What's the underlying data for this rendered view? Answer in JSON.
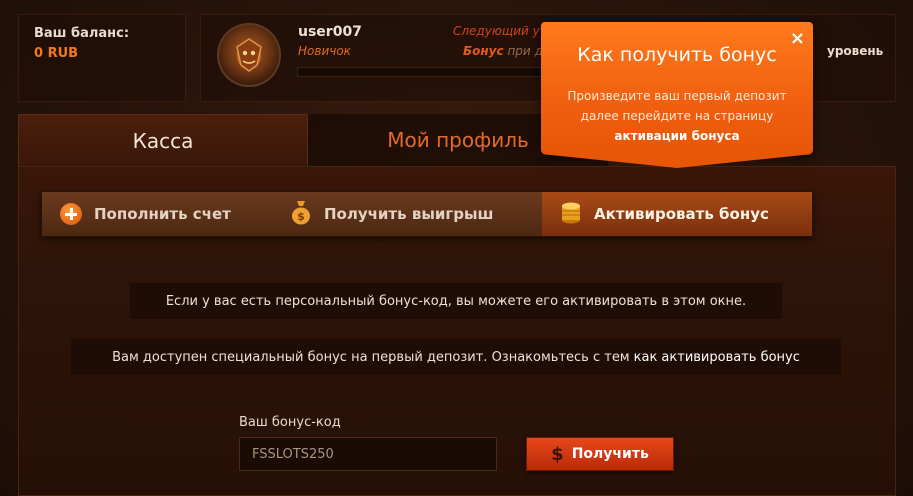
{
  "header": {
    "balance_label": "Ваш баланс:",
    "balance_value": "0 RUB",
    "username": "user007",
    "rank": "Новичок",
    "next_level_label": "Следующий у",
    "bonus_prefix": "Бонус",
    "bonus_suffix": "при д",
    "level_suffix": "уровень",
    "progress_percent": 0
  },
  "tabs": [
    {
      "label": "Касса",
      "active": true
    },
    {
      "label": "Мой профиль",
      "active": false
    }
  ],
  "subnav": {
    "topup": {
      "label": "Пополнить счет",
      "icon": "plus-circle-icon"
    },
    "withdraw": {
      "label": "Получить выигрыш",
      "icon": "money-bag-icon"
    },
    "activate": {
      "label": "Активировать бонус",
      "icon": "coins-stack-icon",
      "active": true
    }
  },
  "info": {
    "line1": "Если у вас есть персональный бонус-код, вы можете его активировать в этом окне.",
    "line2_text": "Вам доступен специальный бонус на первый депозит. Ознакомьтесь с тем",
    "line2_link": "как активировать бонус"
  },
  "bonus_form": {
    "label": "Ваш бонус-код",
    "value": "FSSLOTS250",
    "button_label": "Получить"
  },
  "popup": {
    "title": "Как получить бонус",
    "text_line1": "Произведите ваш первый депозит",
    "text_line2": "далее перейдите на страницу",
    "text_link": "активации бонуса",
    "close": "×"
  },
  "colors": {
    "accent": "#f06010",
    "button": "#d83a12",
    "background": "#2a150a"
  }
}
